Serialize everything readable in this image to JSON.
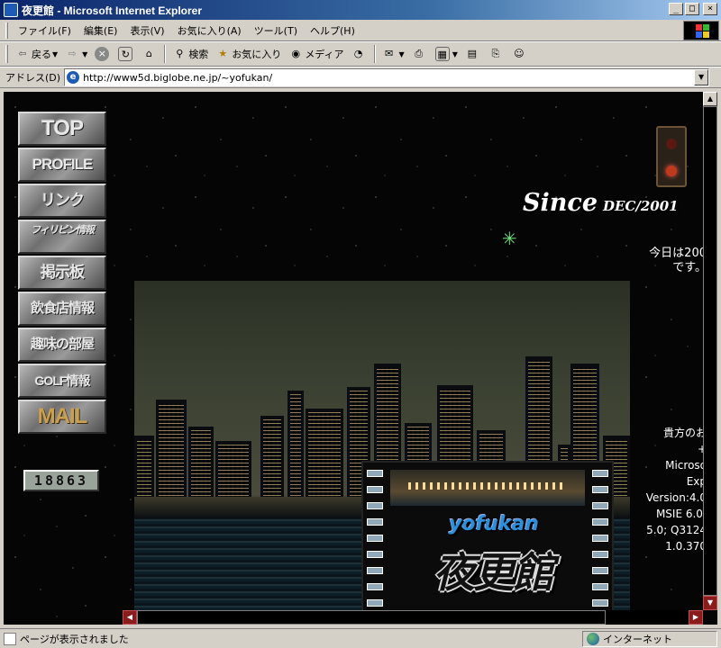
{
  "window": {
    "title": "夜更館 - Microsoft Internet Explorer",
    "buttons": {
      "minimize": "_",
      "maximize": "□",
      "close": "×"
    }
  },
  "menu": [
    "ファイル(F)",
    "編集(E)",
    "表示(V)",
    "お気に入り(A)",
    "ツール(T)",
    "ヘルプ(H)"
  ],
  "toolbar": {
    "back": "戻る",
    "search": "検索",
    "favorites": "お気に入り",
    "media": "メディア"
  },
  "address": {
    "label": "アドレス(D)",
    "url": "http://www5d.biglobe.ne.jp/~yofukan/"
  },
  "page": {
    "nav": [
      {
        "id": "top",
        "label": "TOP"
      },
      {
        "id": "profile",
        "label": "PROFILE"
      },
      {
        "id": "link",
        "label": "リンク"
      },
      {
        "id": "philippines",
        "label": "フィリピン情報"
      },
      {
        "id": "bbs",
        "label": "掲示板"
      },
      {
        "id": "restaurant",
        "label": "飲食店情報"
      },
      {
        "id": "hobby",
        "label": "趣味の部屋"
      },
      {
        "id": "golf",
        "label": "GOLF情報"
      },
      {
        "id": "mail",
        "label": "MAIL"
      }
    ],
    "counter": "18863",
    "since": "Since",
    "since_date": "DEC/2001",
    "date_line1": "今日は200",
    "date_line2": "です。",
    "ua_lines": [
      "貴方のお",
      "+",
      "Microso",
      "Exp",
      "Version:4.0",
      "MSIE 6.0;",
      "5.0; Q3124",
      "1.0.370"
    ],
    "logo_en": "yofukan",
    "logo_ja": "夜更館"
  },
  "status": {
    "text": "ページが表示されました",
    "zone": "インターネット"
  },
  "colors": {
    "titlebar": "#0a246a",
    "chrome": "#d4d0c8",
    "page_bg": "#050505",
    "logo_blue": "#2b8fdc",
    "star_green": "#6fe07a"
  }
}
